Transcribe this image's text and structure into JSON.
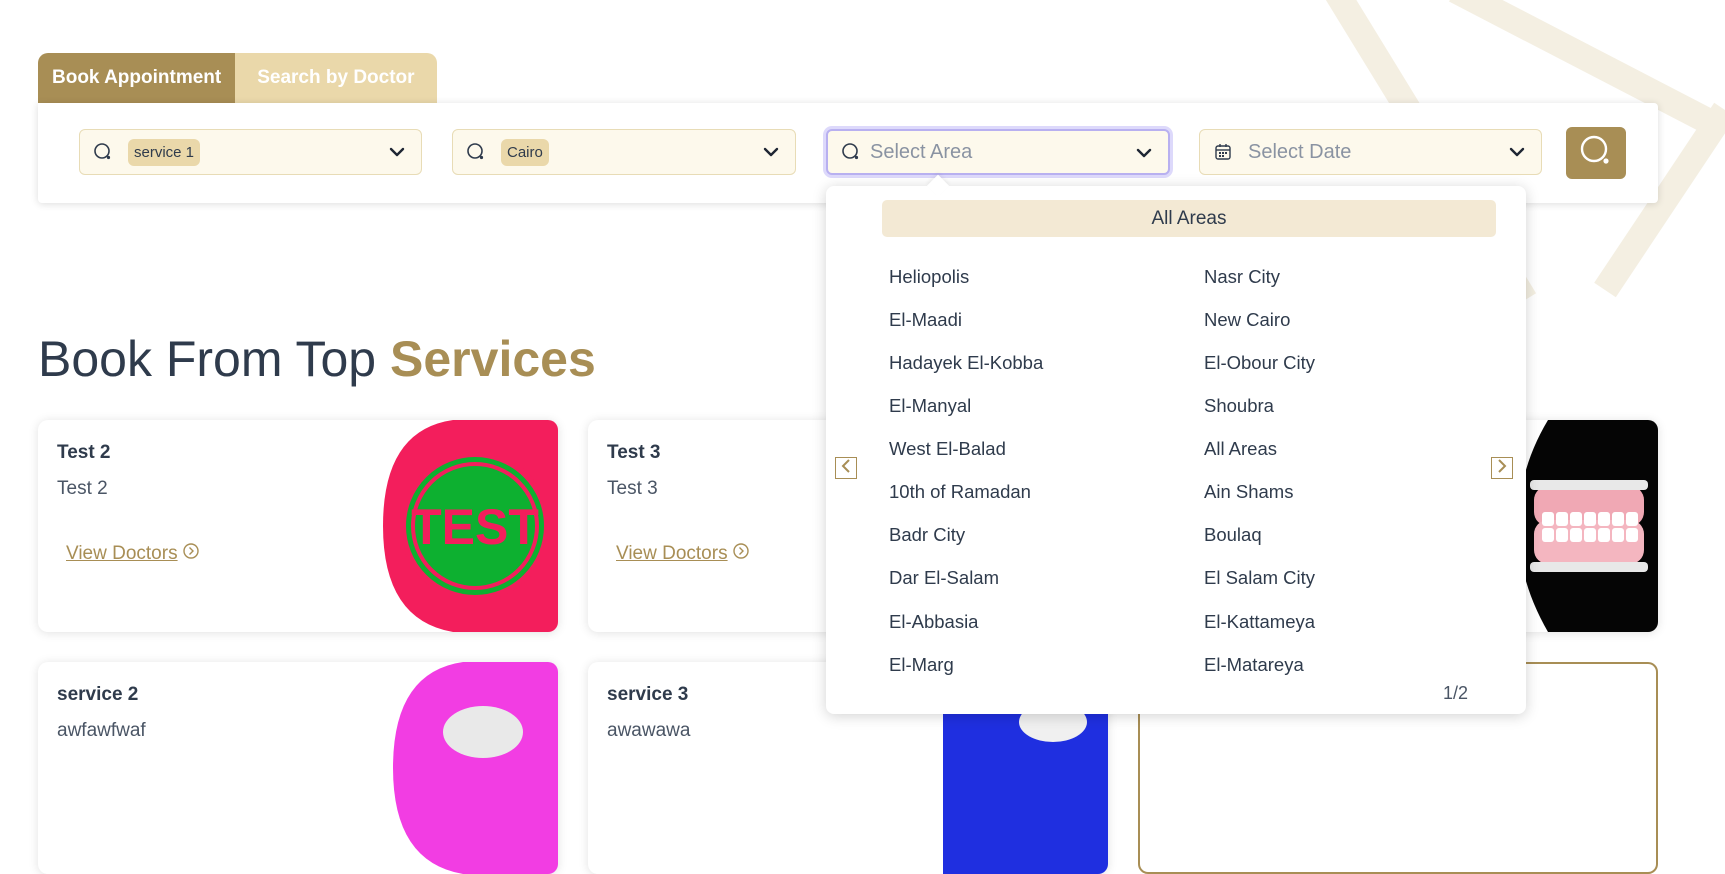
{
  "tabs": {
    "book_appointment": "Book Appointment",
    "search_by_doctor": "Search by Doctor"
  },
  "search": {
    "service_chip": "service 1",
    "city_chip": "Cairo",
    "area_placeholder": "Select Area",
    "date_placeholder": "Select Date"
  },
  "section": {
    "title_prefix": "Book From Top ",
    "title_highlight": "Services"
  },
  "cards": [
    {
      "title": "Test 2",
      "description": "Test 2",
      "link": "View Doctors",
      "image": "test-stamp-image"
    },
    {
      "title": "Test 3",
      "description": "Test 3",
      "link": "View Doctors",
      "image": ""
    },
    {
      "title": "",
      "description": "",
      "link": "",
      "image": "dental-model-image"
    },
    {
      "title": "service 2",
      "description": "awfawfwaf",
      "image": "tooth-image-magenta"
    },
    {
      "title": "service 3",
      "description": "awawawa",
      "image": "tooth-image-blue"
    }
  ],
  "dropdown": {
    "header": "All Areas",
    "left_column": [
      "Heliopolis",
      "El-Maadi",
      "Hadayek El-Kobba",
      "El-Manyal",
      "West El-Balad",
      "10th of Ramadan",
      "Badr City",
      "Dar El-Salam",
      "El-Abbasia",
      "El-Marg"
    ],
    "right_column": [
      "Nasr City",
      "New Cairo",
      "El-Obour City",
      "Shoubra",
      "All Areas",
      "Ain Shams",
      "Boulaq",
      "El Salam City",
      "El-Kattameya",
      "El-Matareya"
    ],
    "page_indicator": "1/2"
  },
  "colors": {
    "brand_gold": "#a88e55",
    "tab_light": "#ead8aa",
    "field_bg": "#fdf9ec",
    "focus_ring": "#b8b0f0"
  }
}
